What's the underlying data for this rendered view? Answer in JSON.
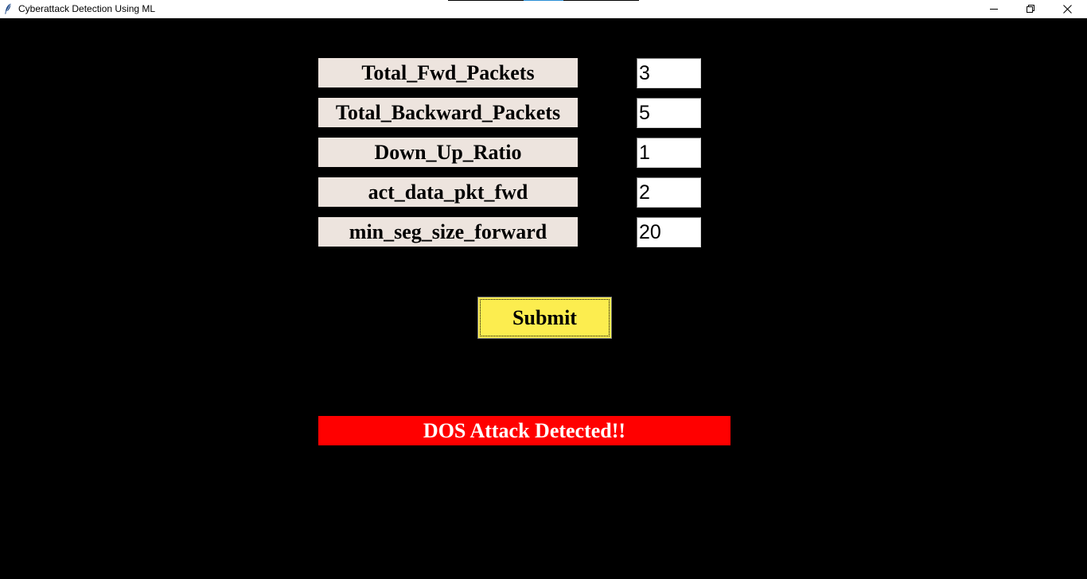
{
  "window": {
    "title": "Cyberattack Detection Using ML",
    "icon": "feather-icon",
    "controls": [
      "minimize-icon",
      "restore-icon",
      "close-icon"
    ]
  },
  "form": {
    "fields": [
      {
        "label": "Total_Fwd_Packets",
        "value": "3"
      },
      {
        "label": "Total_Backward_Packets",
        "value": "5"
      },
      {
        "label": "Down_Up_Ratio",
        "value": "1"
      },
      {
        "label": "act_data_pkt_fwd",
        "value": "2"
      },
      {
        "label": "min_seg_size_forward",
        "value": "20"
      }
    ],
    "submit_label": "Submit"
  },
  "result": {
    "text": "DOS Attack Detected!!"
  },
  "colors": {
    "background": "#000000",
    "label_bg": "#ede4de",
    "submit_bg": "#fced4f",
    "result_bg": "#ff0000",
    "result_text": "#ffffff"
  }
}
